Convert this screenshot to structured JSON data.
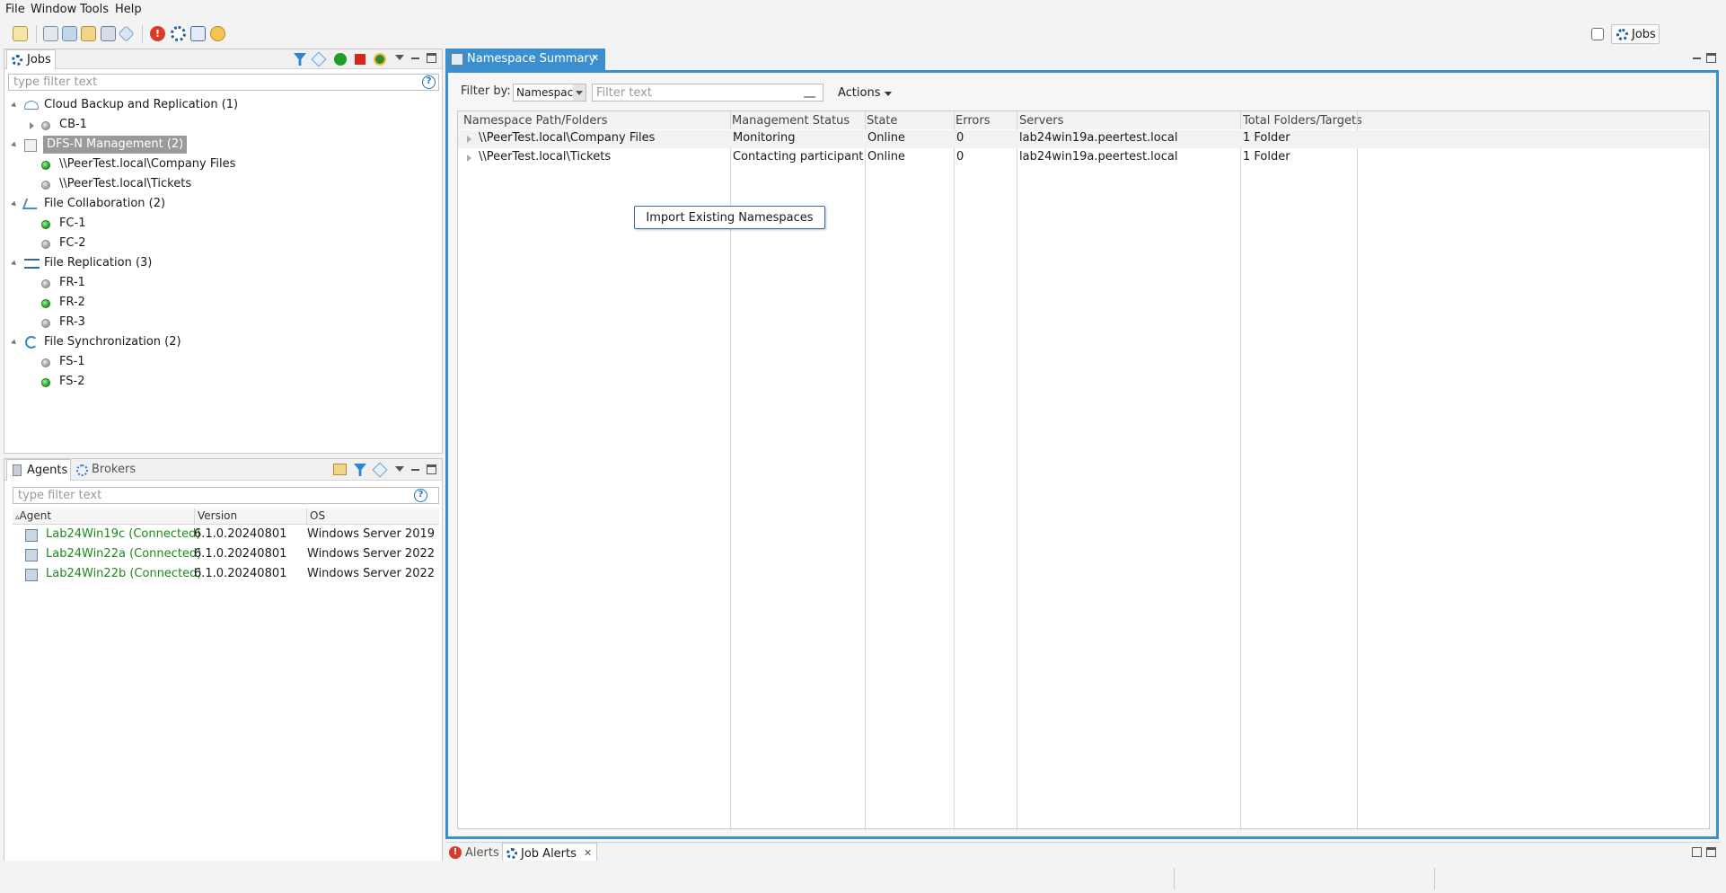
{
  "menubar": {
    "items": [
      "File",
      "Window",
      "Tools",
      "Help"
    ]
  },
  "toolbar": {
    "perspective_label": "Jobs"
  },
  "jobs_view": {
    "tab_label": "Jobs",
    "filter_placeholder": "type filter text",
    "tree": [
      {
        "label": "Cloud Backup and Replication (1)",
        "icon": "cloud-icon",
        "children": [
          {
            "label": "CB-1",
            "status": "grey",
            "expandable": true
          }
        ]
      },
      {
        "label": "DFS-N Management (2)",
        "icon": "dfs-icon",
        "selected": true,
        "children": [
          {
            "label": "\\\\PeerTest.local\\Company Files",
            "status": "green"
          },
          {
            "label": "\\\\PeerTest.local\\Tickets",
            "status": "grey"
          }
        ]
      },
      {
        "label": "File Collaboration (2)",
        "icon": "collaboration-icon",
        "children": [
          {
            "label": "FC-1",
            "status": "green"
          },
          {
            "label": "FC-2",
            "status": "grey"
          }
        ]
      },
      {
        "label": "File Replication (3)",
        "icon": "replication-icon",
        "children": [
          {
            "label": "FR-1",
            "status": "grey"
          },
          {
            "label": "FR-2",
            "status": "green"
          },
          {
            "label": "FR-3",
            "status": "grey"
          }
        ]
      },
      {
        "label": "File Synchronization (2)",
        "icon": "sync-icon",
        "children": [
          {
            "label": "FS-1",
            "status": "grey"
          },
          {
            "label": "FS-2",
            "status": "green"
          }
        ]
      }
    ]
  },
  "agents_view": {
    "tabs": [
      "Agents",
      "Brokers"
    ],
    "filter_placeholder": "type filter text",
    "columns": [
      "Agent",
      "Version",
      "OS"
    ],
    "rows": [
      {
        "agent": "Lab24Win19c (Connected)",
        "version": "6.1.0.20240801",
        "os": "Windows Server 2019"
      },
      {
        "agent": "Lab24Win22a (Connected)",
        "version": "6.1.0.20240801",
        "os": "Windows Server 2022"
      },
      {
        "agent": "Lab24Win22b (Connected)",
        "version": "6.1.0.20240801",
        "os": "Windows Server 2022"
      }
    ]
  },
  "namespace_view": {
    "tab_label": "Namespace Summary",
    "filter_by_label": "Filter by:",
    "filter_by_value": "Namespac",
    "filter_placeholder": "Filter text",
    "actions_label": "Actions",
    "columns": [
      "Namespace Path/Folders",
      "Management Status",
      "State",
      "Errors",
      "Servers",
      "Total Folders/Targets"
    ],
    "rows": [
      {
        "path": "\\\\PeerTest.local\\Company Files",
        "management_status": "Monitoring",
        "state": "Online",
        "errors": "0",
        "servers": "lab24win19a.peertest.local",
        "total": "1 Folder"
      },
      {
        "path": "\\\\PeerTest.local\\Tickets",
        "management_status": "Contacting participant ...",
        "state": "Online",
        "errors": "0",
        "servers": "lab24win19a.peertest.local",
        "total": "1 Folder"
      }
    ],
    "import_button_label": "Import Existing Namespaces"
  },
  "bottom_view": {
    "tabs": [
      "Alerts",
      "Job Alerts"
    ]
  },
  "colors": {
    "accent": "#3c8fcf",
    "connected_text": "#1b8a1b",
    "status_green": "#1c9c1c"
  }
}
